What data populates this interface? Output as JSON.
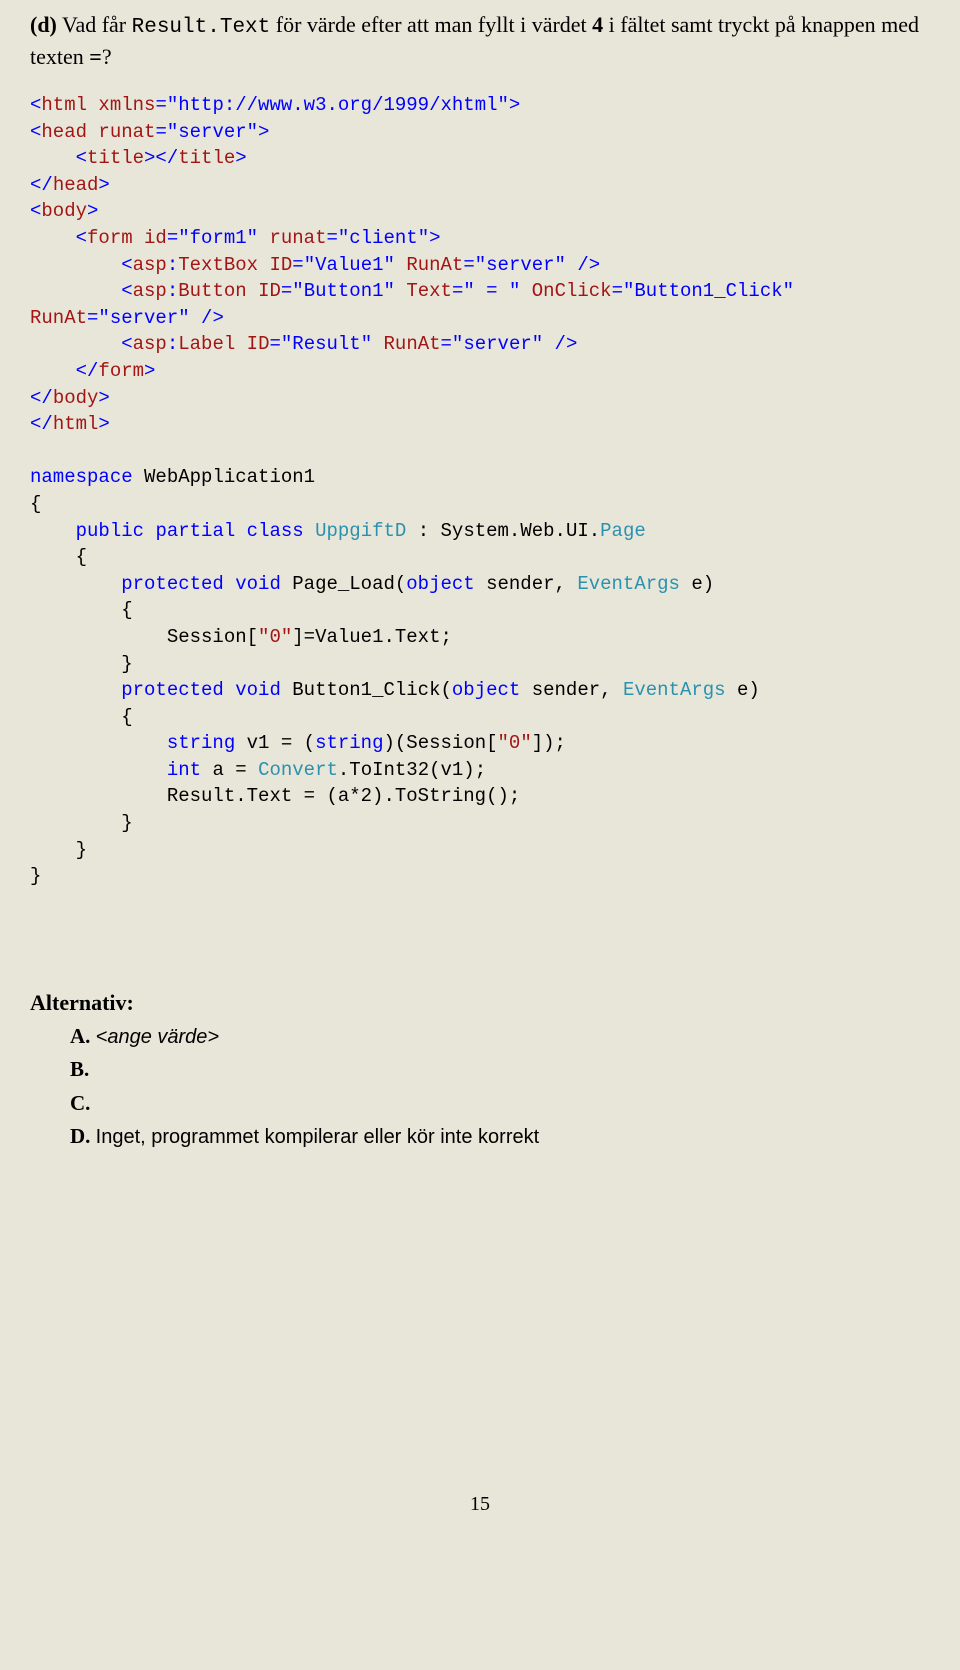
{
  "question": {
    "label": "(d)",
    "prefix": " Vad får ",
    "mono": "Result.Text",
    "middle": " för värde efter att man fyllt i värdet ",
    "value": "4",
    "suffix1": " i fältet samt tryckt på knappen med texten ",
    "suffix2": "=",
    "suffix3": "?"
  },
  "code": {
    "l1a": "<",
    "l1b": "html",
    "l1c": " ",
    "l1d": "xmlns",
    "l1e": "=\"http://www.w3.org/1999/xhtml\">",
    "l2a": "<",
    "l2b": "head",
    "l2c": " ",
    "l2d": "runat",
    "l2e": "=\"server\">",
    "l3a": "    <",
    "l3b": "title",
    "l3c": "></",
    "l3d": "title",
    "l3e": ">",
    "l4a": "</",
    "l4b": "head",
    "l4c": ">",
    "l5a": "<",
    "l5b": "body",
    "l5c": ">",
    "l6a": "    <",
    "l6b": "form",
    "l6c": " ",
    "l6d": "id",
    "l6e": "=\"form1\"",
    "l6f": " ",
    "l6g": "runat",
    "l6h": "=\"client\">",
    "l7a": "        <",
    "l7b": "asp",
    "l7c": ":",
    "l7d": "TextBox",
    "l7e": " ",
    "l7f": "ID",
    "l7g": "=\"Value1\"",
    "l7h": " ",
    "l7i": "RunAt",
    "l7j": "=\"server\"",
    "l7k": " />",
    "l8a": "        <",
    "l8b": "asp",
    "l8c": ":",
    "l8d": "Button",
    "l8e": " ",
    "l8f": "ID",
    "l8g": "=\"Button1\"",
    "l8h": " ",
    "l8i": "Text",
    "l8j": "=\" = \"",
    "l8k": " ",
    "l8l": "OnClick",
    "l8m": "=\"Button1_Click\"",
    "l9a": "RunAt",
    "l9b": "=\"server\"",
    "l9c": " />",
    "l10a": "        <",
    "l10b": "asp",
    "l10c": ":",
    "l10d": "Label",
    "l10e": " ",
    "l10f": "ID",
    "l10g": "=\"Result\"",
    "l10h": " ",
    "l10i": "RunAt",
    "l10j": "=\"server\"",
    "l10k": " />",
    "l11a": "    </",
    "l11b": "form",
    "l11c": ">",
    "l12a": "</",
    "l12b": "body",
    "l12c": ">",
    "l13a": "</",
    "l13b": "html",
    "l13c": ">",
    "blank1": "",
    "n1a": "namespace",
    "n1b": " WebApplication1",
    "n2": "{",
    "n3a": "    ",
    "n3b": "public",
    "n3c": " ",
    "n3d": "partial",
    "n3e": " ",
    "n3f": "class",
    "n3g": " ",
    "n3h": "UppgiftD",
    "n3i": " : System.Web.UI.",
    "n3j": "Page",
    "n4": "    {",
    "n5a": "        ",
    "n5b": "protected",
    "n5c": " ",
    "n5d": "void",
    "n5e": " Page_Load(",
    "n5f": "object",
    "n5g": " sender, ",
    "n5h": "EventArgs",
    "n5i": " e)",
    "n6": "        {",
    "n7a": "            Session[",
    "n7b": "\"0\"",
    "n7c": "]=Value1.Text;",
    "n8": "        }",
    "n9a": "        ",
    "n9b": "protected",
    "n9c": " ",
    "n9d": "void",
    "n9e": " Button1_Click(",
    "n9f": "object",
    "n9g": " sender, ",
    "n9h": "EventArgs",
    "n9i": " e)",
    "n10": "        {",
    "n11a": "            ",
    "n11b": "string",
    "n11c": " v1 = (",
    "n11d": "string",
    "n11e": ")(Session[",
    "n11f": "\"0\"",
    "n11g": "]);",
    "n12a": "            ",
    "n12b": "int",
    "n12c": " a = ",
    "n12d": "Convert",
    "n12e": ".ToInt32(v1);",
    "n13": "            Result.Text = (a*2).ToString();",
    "n14": "        }",
    "n15": "    }",
    "n16": "}"
  },
  "alternativ": {
    "heading": "Alternativ:",
    "a_letter": "A.",
    "a_text": "<ange värde>",
    "b_letter": "B.",
    "c_letter": "C.",
    "d_letter": "D.",
    "d_text": "Inget, programmet kompilerar eller kör inte korrekt"
  },
  "page_num": "15"
}
